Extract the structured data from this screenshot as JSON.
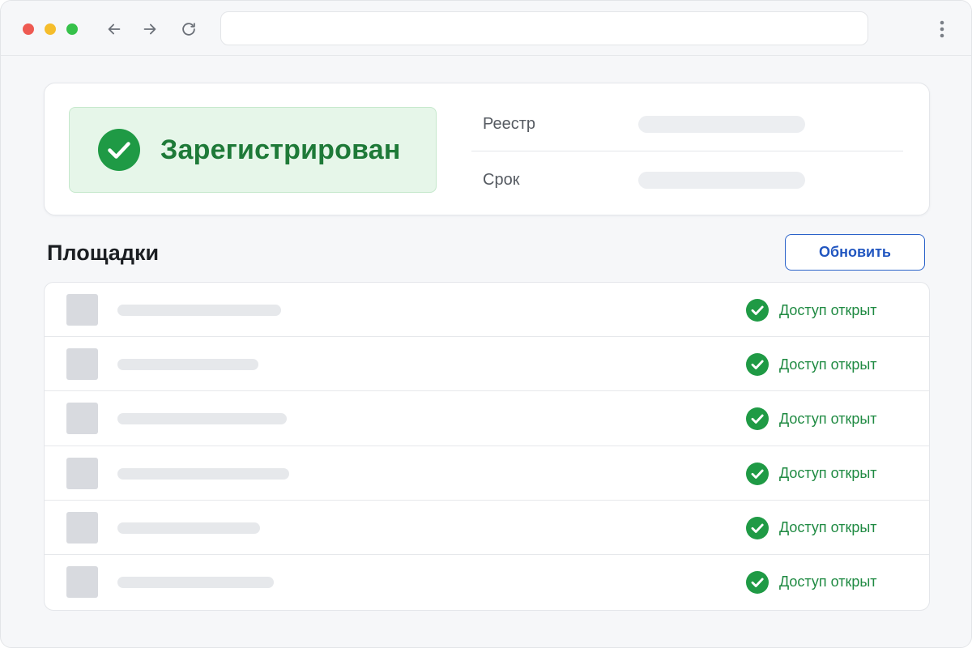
{
  "browser": {
    "address_value": "",
    "icons": {
      "back": "arrow-left-icon",
      "forward": "arrow-right-icon",
      "reload": "reload-icon",
      "menu": "vertical-dots-icon"
    }
  },
  "status": {
    "label": "Зарегистрирован",
    "icon": "check-circle-icon",
    "color": "#1e7a38",
    "background": "#e6f6e9"
  },
  "info": [
    {
      "label": "Реестр",
      "value": ""
    },
    {
      "label": "Срок",
      "value": ""
    }
  ],
  "platforms": {
    "title": "Площадки",
    "refresh_label": "Обновить",
    "accent": "#2156c0",
    "items": [
      {
        "name": "",
        "status": "Доступ открыт"
      },
      {
        "name": "",
        "status": "Доступ открыт"
      },
      {
        "name": "",
        "status": "Доступ открыт"
      },
      {
        "name": "",
        "status": "Доступ открыт"
      },
      {
        "name": "",
        "status": "Доступ открыт"
      },
      {
        "name": "",
        "status": "Доступ открыт"
      }
    ],
    "status_color": "#1f8a42"
  }
}
